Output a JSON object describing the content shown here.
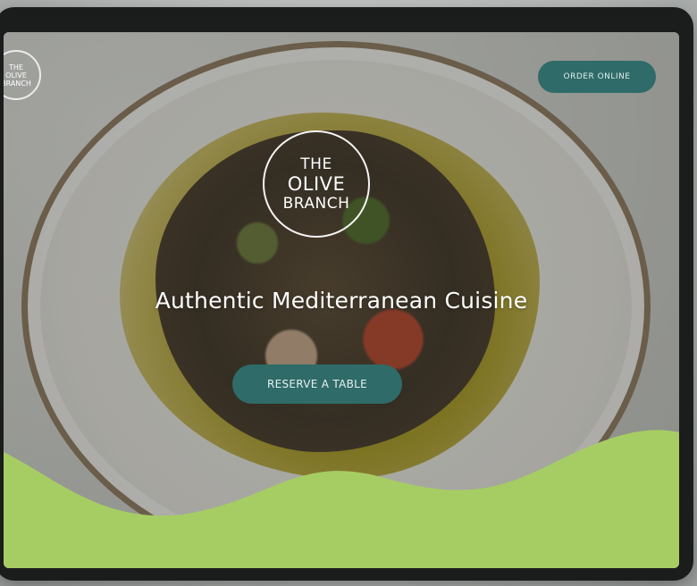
{
  "site": {
    "corner_logo_text": "THE OLIVE BRANCH",
    "brand_line1": "THE",
    "brand_line2": "OLIVE",
    "brand_line3": "BRANCH"
  },
  "header": {
    "order_button_label": "ORDER ONLINE"
  },
  "hero": {
    "headline": "Authentic Mediterranean Cuisine",
    "cta_label": "RESERVE A TABLE"
  },
  "colors": {
    "accent_teal": "#2f6b68",
    "wave_green": "#a6cd63"
  }
}
